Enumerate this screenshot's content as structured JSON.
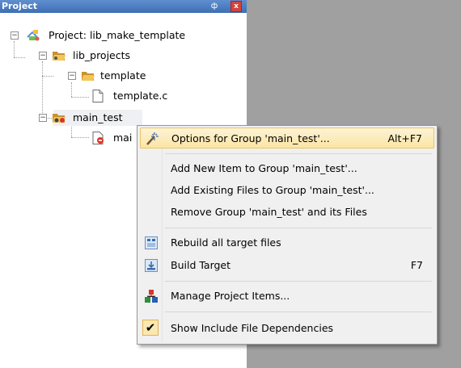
{
  "panel": {
    "title": "Project",
    "pin_glyph": "ф",
    "close_glyph": "x"
  },
  "tree": {
    "root": "Project: lib_make_template",
    "group1": "lib_projects",
    "group2": "template",
    "file1": "template.c",
    "group3": "main_test",
    "file2": "mai",
    "collapse_glyph": "−"
  },
  "menu": {
    "items": [
      {
        "label": "Options for Group 'main_test'...",
        "shortcut": "Alt+F7",
        "icon": "options-wand-icon"
      },
      {
        "label": "Add New  Item to Group 'main_test'...",
        "shortcut": ""
      },
      {
        "label": "Add Existing Files to Group 'main_test'...",
        "shortcut": ""
      },
      {
        "label": "Remove Group 'main_test' and its Files",
        "shortcut": ""
      },
      {
        "label": "Rebuild all target files",
        "shortcut": "",
        "icon": "rebuild-icon"
      },
      {
        "label": "Build Target",
        "shortcut": "F7",
        "icon": "build-icon"
      },
      {
        "label": "Manage Project Items...",
        "shortcut": "",
        "icon": "manage-items-icon"
      },
      {
        "label": "Show Include File Dependencies",
        "shortcut": "",
        "checked": true
      }
    ],
    "check_glyph": "✔"
  },
  "colors": {
    "header": "#4a7cc0",
    "highlight": "#fbe5a4",
    "folder": "#e8b84a",
    "background_gray": "#a0a0a0"
  }
}
